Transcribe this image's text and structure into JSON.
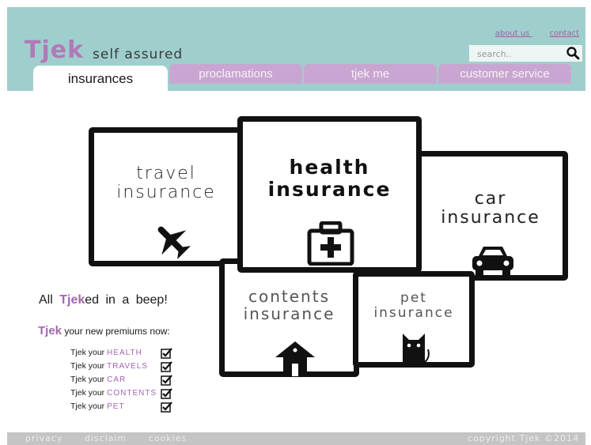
{
  "brand": {
    "logo": "Tjek",
    "tagline": "self assured"
  },
  "top_links": {
    "about": "about us",
    "contact": "contact"
  },
  "search": {
    "placeholder": "search.."
  },
  "tabs": [
    {
      "label": "insurances",
      "active": true
    },
    {
      "label": "proclamations"
    },
    {
      "label": "tjek me"
    },
    {
      "label": "customer service"
    }
  ],
  "insurances": {
    "travel": {
      "line1": "travel",
      "line2": "insurance",
      "icon": "airplane-icon"
    },
    "health": {
      "line1": "health",
      "line2": "insurance",
      "icon": "medical-kit-icon"
    },
    "car": {
      "line1": "car",
      "line2": "insurance",
      "icon": "car-icon"
    },
    "contents": {
      "line1": "contents",
      "line2": "insurance",
      "icon": "house-icon"
    },
    "pet": {
      "line1": "pet",
      "line2": "insurance",
      "icon": "cat-icon"
    }
  },
  "promo": {
    "prefix": "All",
    "brand": "Tjek",
    "suffix": "ed in a beep!",
    "premiums_brand": "Tjek",
    "premiums_text": "your new premiums now:"
  },
  "checklist": [
    {
      "prefix": "Tjek your",
      "item": "HEALTH",
      "checked": true
    },
    {
      "prefix": "Tjek your",
      "item": "TRAVELS",
      "checked": true
    },
    {
      "prefix": "Tjek your",
      "item": "CAR",
      "checked": true
    },
    {
      "prefix": "Tjek your",
      "item": "CONTENTS",
      "checked": true
    },
    {
      "prefix": "Tjek your",
      "item": "PET",
      "checked": true
    }
  ],
  "footer": {
    "privacy": "privacy",
    "disclaim": "disclaim",
    "cookies": "cookies",
    "copyright": "copyright Tjek ©2014"
  },
  "colors": {
    "header_bg": "#9fcfcd",
    "tab_bg": "#c9a6d1",
    "accent": "#a366b0",
    "footer_bg": "#c4c4c4"
  }
}
